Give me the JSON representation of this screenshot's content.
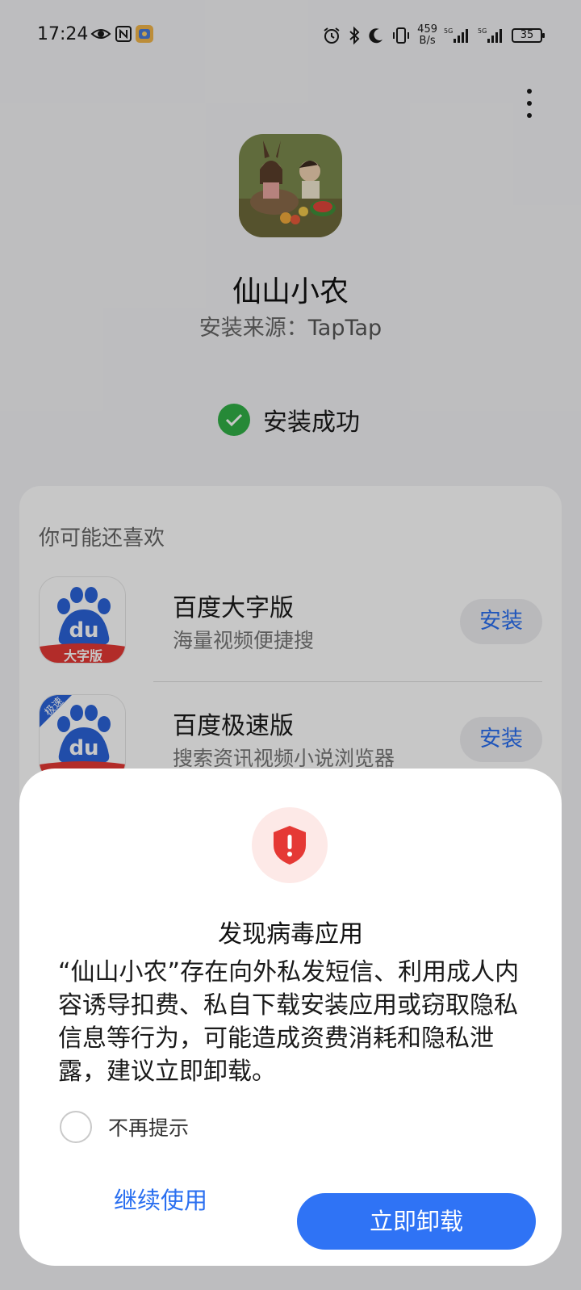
{
  "status_bar": {
    "time": "17:24",
    "net_speed_value": "459",
    "net_speed_unit": "B/s",
    "signal_label_1": "5G",
    "signal_label_2": "5G",
    "battery": "35"
  },
  "app": {
    "name": "仙山小农",
    "source_label": "安装来源：",
    "source_value": "TapTap",
    "install_status": "安装成功"
  },
  "recommendations": {
    "title": "你可能还喜欢",
    "items": [
      {
        "name": "百度大字版",
        "desc": "海量视频便捷搜",
        "button": "安装",
        "icon_badge": "大字版"
      },
      {
        "name": "百度极速版",
        "desc": "搜索资讯视频小说浏览器",
        "button": "安装",
        "icon_corner": "极速"
      }
    ]
  },
  "dialog": {
    "title": "发现病毒应用",
    "message": "“仙山小农”存在向外私发短信、利用成人内容诱导扣费、私自下载安装应用或窃取隐私信息等行为，可能造成资费消耗和隐私泄露，建议立即卸载。",
    "dont_remind": "不再提示",
    "continue_label": "继续使用",
    "uninstall_label": "立即卸载"
  },
  "colors": {
    "accent": "#2f73f5",
    "success": "#31b047",
    "danger": "#e53935",
    "baidu_blue": "#2b63d9",
    "baidu_red": "#e53935"
  }
}
